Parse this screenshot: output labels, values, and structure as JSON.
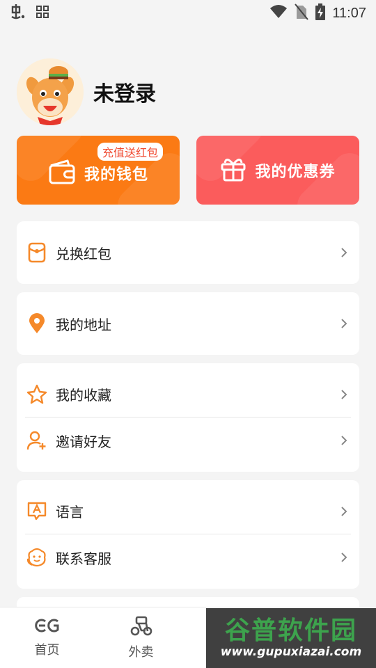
{
  "status_bar": {
    "time": "11:07"
  },
  "profile": {
    "username": "未登录"
  },
  "promo": {
    "wallet_badge": "充值送红包",
    "wallet_label": "我的钱包",
    "coupon_label": "我的优惠券",
    "wallet_color": "#fb7a14",
    "coupon_color": "#fb5c5c"
  },
  "menu": {
    "redeem": "兑换红包",
    "address": "我的地址",
    "favorites": "我的收藏",
    "invite": "邀请好友",
    "language": "语言",
    "support": "联系客服"
  },
  "bottom_nav": {
    "home": "首页",
    "delivery": "外卖"
  },
  "watermark": {
    "title": "谷普软件园",
    "url": "www.gupuxiazai.com"
  },
  "accent_color": "#f5892a"
}
